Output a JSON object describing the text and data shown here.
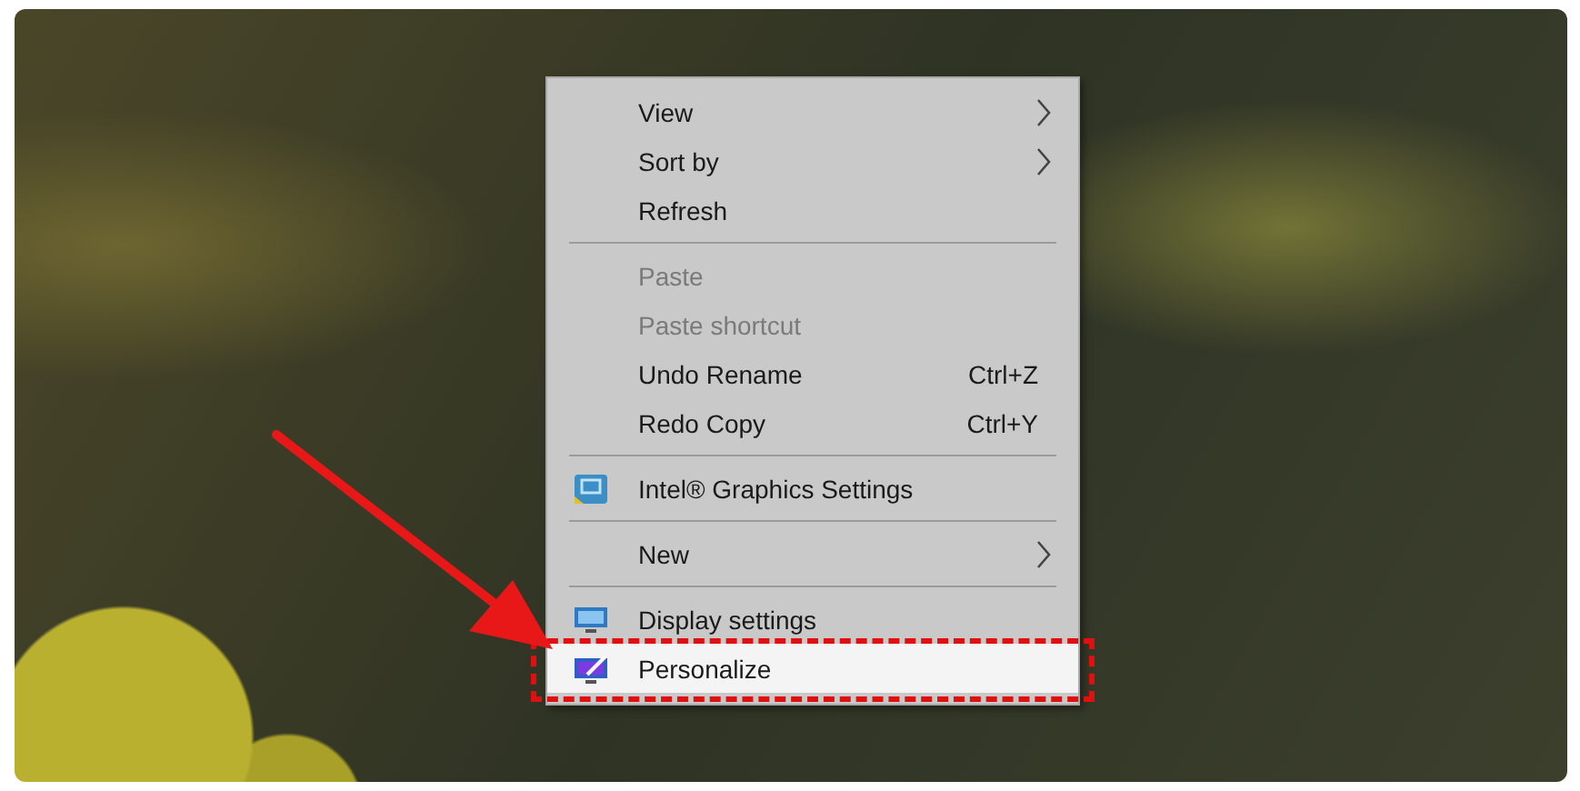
{
  "context_menu": {
    "items": [
      {
        "kind": "item",
        "label": "View",
        "submenu": true,
        "disabled": false,
        "selected": false,
        "callout": false
      },
      {
        "kind": "item",
        "label": "Sort by",
        "submenu": true,
        "disabled": false,
        "selected": false,
        "callout": false
      },
      {
        "kind": "item",
        "label": "Refresh",
        "submenu": false,
        "disabled": false,
        "selected": false,
        "callout": false
      },
      {
        "kind": "separator"
      },
      {
        "kind": "item",
        "label": "Paste",
        "submenu": false,
        "disabled": true,
        "selected": false,
        "callout": false
      },
      {
        "kind": "item",
        "label": "Paste shortcut",
        "submenu": false,
        "disabled": true,
        "selected": false,
        "callout": false
      },
      {
        "kind": "item",
        "label": "Undo Rename",
        "shortcut": "Ctrl+Z",
        "submenu": false,
        "disabled": false,
        "selected": false,
        "callout": false
      },
      {
        "kind": "item",
        "label": "Redo Copy",
        "shortcut": "Ctrl+Y",
        "submenu": false,
        "disabled": false,
        "selected": false,
        "callout": false
      },
      {
        "kind": "separator"
      },
      {
        "kind": "icon_item",
        "label": "Intel® Graphics Settings",
        "submenu": false,
        "disabled": false,
        "selected": false,
        "callout": false
      },
      {
        "kind": "separator"
      },
      {
        "kind": "item",
        "label": "New",
        "submenu": true,
        "disabled": false,
        "selected": false,
        "callout": false
      },
      {
        "kind": "separator"
      },
      {
        "kind": "icon_item",
        "label": "Display settings",
        "submenu": false,
        "disabled": false,
        "selected": false,
        "callout": false
      },
      {
        "kind": "icon_item",
        "label": "Personalize",
        "submenu": false,
        "disabled": false,
        "selected": true,
        "callout": true
      }
    ]
  }
}
